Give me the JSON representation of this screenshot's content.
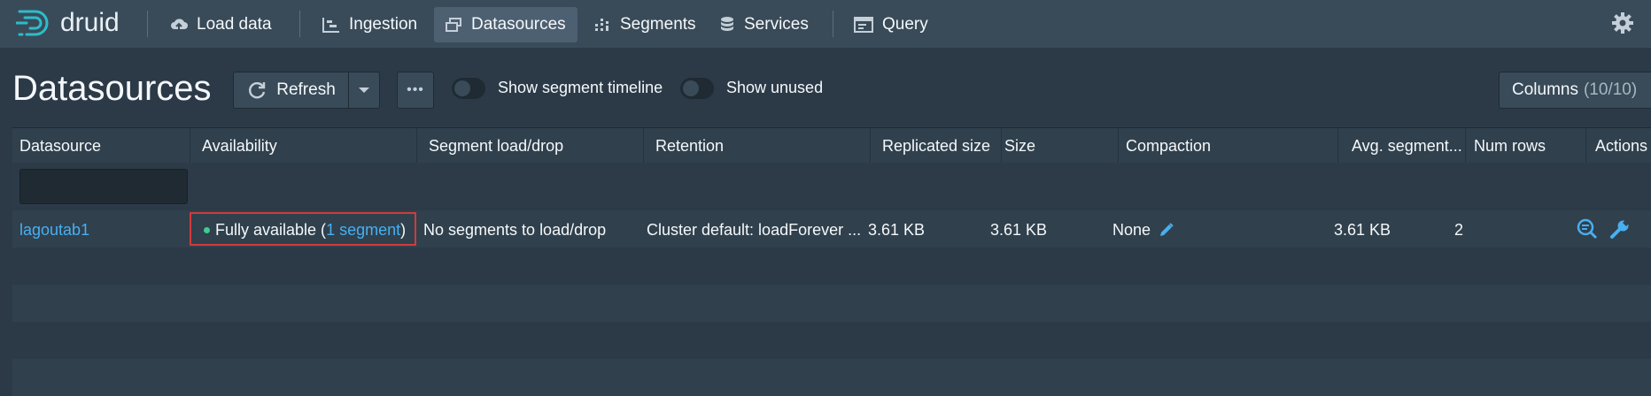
{
  "nav": {
    "brand": "druid",
    "items": [
      {
        "label": "Load data",
        "icon": "cloud-upload-icon"
      },
      {
        "label": "Ingestion",
        "icon": "gantt-chart-icon"
      },
      {
        "label": "Datasources",
        "icon": "multi-select-icon",
        "active": true
      },
      {
        "label": "Segments",
        "icon": "stacked-chart-icon"
      },
      {
        "label": "Services",
        "icon": "database-icon"
      },
      {
        "label": "Query",
        "icon": "application-icon"
      }
    ],
    "settings_icon": "gear-icon"
  },
  "header": {
    "title": "Datasources",
    "refresh_label": "Refresh",
    "more_label": "•••",
    "toggle_timeline_label": "Show segment timeline",
    "toggle_unused_label": "Show unused",
    "columns_label": "Columns",
    "columns_count": "(10/10)"
  },
  "table": {
    "columns": [
      "Datasource",
      "Availability",
      "Segment load/drop",
      "Retention",
      "Replicated size",
      "Size",
      "Compaction",
      "Avg. segment...",
      "Num rows",
      "Actions"
    ],
    "rows": [
      {
        "datasource": "lagoutab1",
        "availability_text": "Fully available (",
        "availability_link": "1 segment",
        "availability_close": ")",
        "segment_load_drop": "No segments to load/drop",
        "retention": "Cluster default: loadForever ...",
        "replicated_size": "3.61 KB",
        "size": "3.61 KB",
        "compaction": "None",
        "avg_segment": "3.61 KB",
        "num_rows": "2"
      }
    ]
  },
  "colors": {
    "accent": "#48aff0",
    "status_green": "#3dcc91",
    "highlight": "#d43a3a"
  }
}
